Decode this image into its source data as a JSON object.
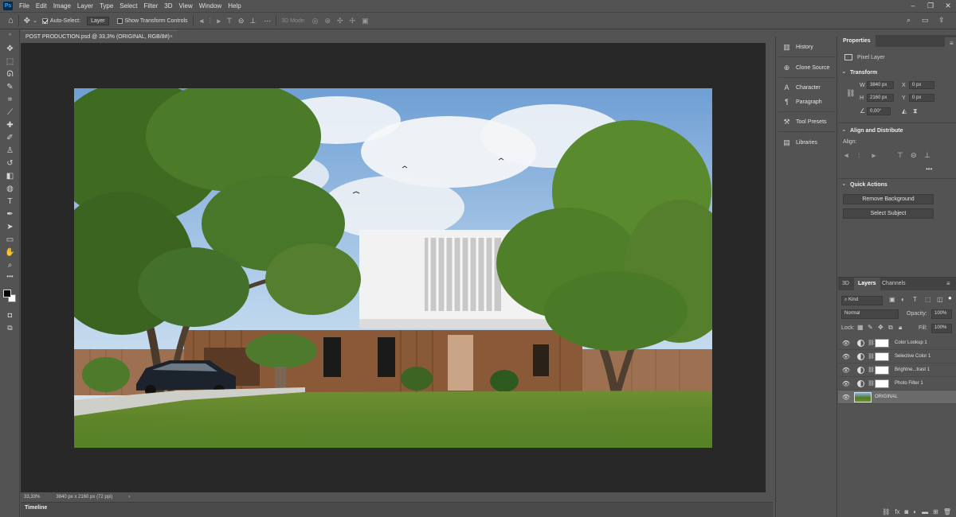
{
  "menubar": {
    "items": [
      "File",
      "Edit",
      "Image",
      "Layer",
      "Type",
      "Select",
      "Filter",
      "3D",
      "View",
      "Window",
      "Help"
    ],
    "logo": "Ps"
  },
  "options": {
    "auto_select_label": "Auto-Select:",
    "auto_select_value": "Layer",
    "show_transform_label": "Show Transform Controls",
    "mode_3d_label": "3D Mode:"
  },
  "document": {
    "tab_title": "POST PRODUCTION.psd @ 33,3% (ORIGINAL, RGB/8#)",
    "zoom": "33,33%",
    "doc_size": "3840 px x 2160 px (72 ppi)"
  },
  "timeline": {
    "label": "Timeline"
  },
  "panel_strip": {
    "items": [
      {
        "label": "History",
        "icon": "history-icon"
      },
      {
        "label": "Clone Source",
        "icon": "clone-source-icon"
      },
      {
        "label": "Character",
        "icon": "character-icon"
      },
      {
        "label": "Paragraph",
        "icon": "paragraph-icon"
      },
      {
        "label": "Tool Presets",
        "icon": "tool-presets-icon"
      },
      {
        "label": "Libraries",
        "icon": "libraries-icon"
      }
    ]
  },
  "properties": {
    "tab": "Properties",
    "layer_kind": "Pixel Layer",
    "transform_title": "Transform",
    "w_label": "W",
    "w_value": "3840 px",
    "h_label": "H",
    "h_value": "2160 px",
    "x_label": "X",
    "x_value": "0 px",
    "y_label": "Y",
    "y_value": "0 px",
    "angle": "0,00°",
    "align_title": "Align and Distribute",
    "align_label": "Align:",
    "quick_title": "Quick Actions",
    "remove_bg": "Remove Background",
    "select_subject": "Select Subject"
  },
  "layers_panel": {
    "tabs": [
      "3D",
      "Layers",
      "Channels"
    ],
    "kind": "Kind",
    "blend_mode": "Normal",
    "opacity_label": "Opacity:",
    "opacity_value": "100%",
    "lock_label": "Lock:",
    "fill_label": "Fill:",
    "fill_value": "100%",
    "layers": [
      {
        "name": "Color Lookup 1",
        "type": "adjustment"
      },
      {
        "name": "Selective Color 1",
        "type": "adjustment"
      },
      {
        "name": "Brightne...trast 1",
        "type": "adjustment"
      },
      {
        "name": "Photo Filter 1",
        "type": "adjustment"
      },
      {
        "name": "ORIGINAL",
        "type": "pixel",
        "selected": true
      }
    ]
  },
  "colors": {
    "ui_bg": "#535353",
    "canvas_bg": "#282828",
    "selected_layer": "#6a6a6a"
  }
}
